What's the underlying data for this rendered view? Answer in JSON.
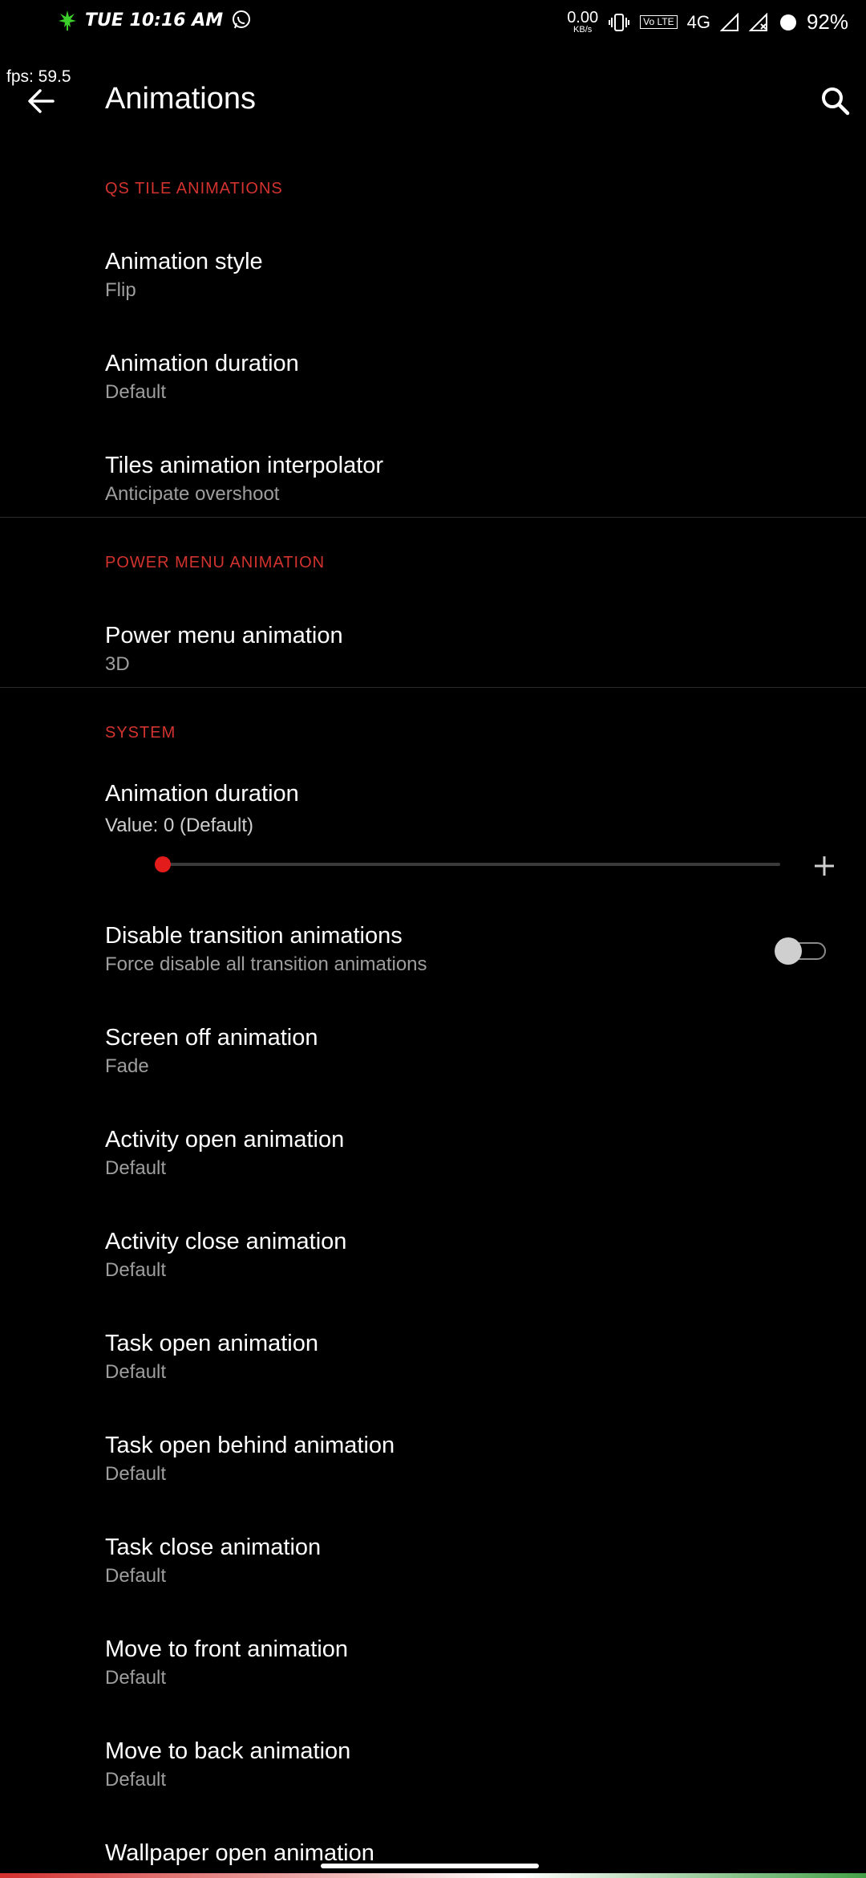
{
  "status": {
    "time": "TUE 10:16 AM",
    "net_speed": "0.00",
    "net_unit": "KB/s",
    "volte": "Vo LTE",
    "network": "4G",
    "battery": "92%",
    "icons": [
      "leaf-icon",
      "whatsapp-icon",
      "vibrate-icon",
      "signal-icon",
      "signal-x-icon",
      "battery-icon"
    ]
  },
  "fps": "fps: 59.5",
  "appbar": {
    "title": "Animations"
  },
  "sections": {
    "qs": "QS TILE ANIMATIONS",
    "power": "POWER MENU ANIMATION",
    "system": "SYSTEM"
  },
  "qs_items": [
    {
      "title": "Animation style",
      "summary": "Flip"
    },
    {
      "title": "Animation duration",
      "summary": "Default"
    },
    {
      "title": "Tiles animation interpolator",
      "summary": "Anticipate overshoot"
    }
  ],
  "power_items": [
    {
      "title": "Power menu animation",
      "summary": "3D"
    }
  ],
  "system_slider": {
    "title": "Animation duration",
    "value": "Value: 0 (Default)",
    "level": 0
  },
  "system_toggle": {
    "title": "Disable transition animations",
    "summary": "Force disable all transition animations",
    "checked": false
  },
  "system_items": [
    {
      "title": "Screen off animation",
      "summary": "Fade"
    },
    {
      "title": "Activity open animation",
      "summary": "Default"
    },
    {
      "title": "Activity close animation",
      "summary": "Default"
    },
    {
      "title": "Task open animation",
      "summary": "Default"
    },
    {
      "title": "Task open behind animation",
      "summary": "Default"
    },
    {
      "title": "Task close animation",
      "summary": "Default"
    },
    {
      "title": "Move to front animation",
      "summary": "Default"
    },
    {
      "title": "Move to back animation",
      "summary": "Default"
    },
    {
      "title": "Wallpaper open animation",
      "summary": ""
    }
  ],
  "colors": {
    "accent": "#d3332e",
    "slider_thumb": "#e31b1b",
    "background": "#000000"
  }
}
